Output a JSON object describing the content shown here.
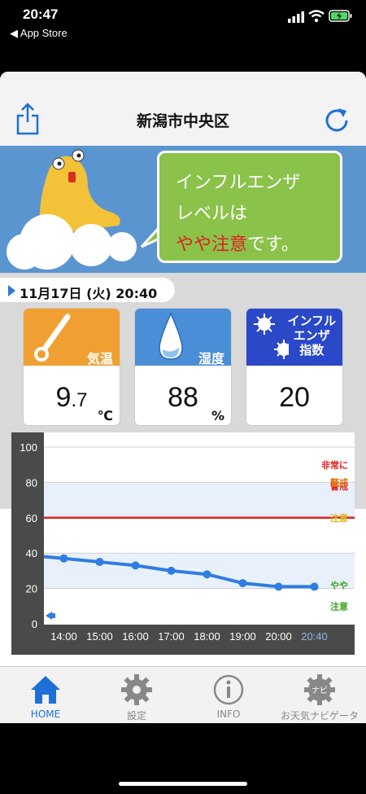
{
  "status": {
    "time": "20:47",
    "back_label": "◀ App Store"
  },
  "nav": {
    "title": "新潟市中央区"
  },
  "banner": {
    "line1": "インフルエンザ",
    "line2": "レベルは",
    "level_text": "やや注意",
    "suffix": "です。"
  },
  "date": {
    "text": "11月17日 (火) 20:40"
  },
  "cards": [
    {
      "label": "気温",
      "value_int": "9",
      "value_dec": ".7",
      "unit": "℃",
      "color": "#f0a032"
    },
    {
      "label": "湿度",
      "value_int": "88",
      "value_dec": "",
      "unit": "%",
      "color": "#4a8ed8"
    },
    {
      "label_l1": "インフル",
      "label_l2": "エンザ",
      "label_l3": "指数",
      "value_int": "20",
      "value_dec": "",
      "unit": "",
      "color": "#2a48c8"
    }
  ],
  "chart_data": {
    "type": "line",
    "x": [
      "14:00",
      "15:00",
      "16:00",
      "17:00",
      "18:00",
      "19:00",
      "20:00",
      "20:40"
    ],
    "values": [
      37,
      35,
      33,
      30,
      28,
      23,
      21,
      21
    ],
    "start_value": 38,
    "ylim": [
      0,
      100
    ],
    "yticks": [
      "100",
      "80",
      "60",
      "40",
      "20",
      "0"
    ],
    "threshold": 60,
    "threshold_color": "#e02020",
    "bands": [
      {
        "label_l1": "非常に",
        "label_l2": "警戒",
        "color": "#e02020"
      },
      {
        "label_l1": "警戒",
        "label_l2": "",
        "color": "#e07a1a"
      },
      {
        "label_l1": "注意",
        "label_l2": "",
        "color": "#d8b820"
      },
      {
        "label_l1": "やや",
        "label_l2": "注意",
        "color": "#3aa020"
      }
    ],
    "line_color": "#2f7de0"
  },
  "tabs": [
    {
      "label": "HOME",
      "icon": "home-icon"
    },
    {
      "label": "設定",
      "icon": "gear-icon"
    },
    {
      "label": "INFO",
      "icon": "info-icon"
    },
    {
      "label": "お天気ナビゲータ",
      "icon": "navi-icon",
      "badge": "ナビ"
    }
  ]
}
